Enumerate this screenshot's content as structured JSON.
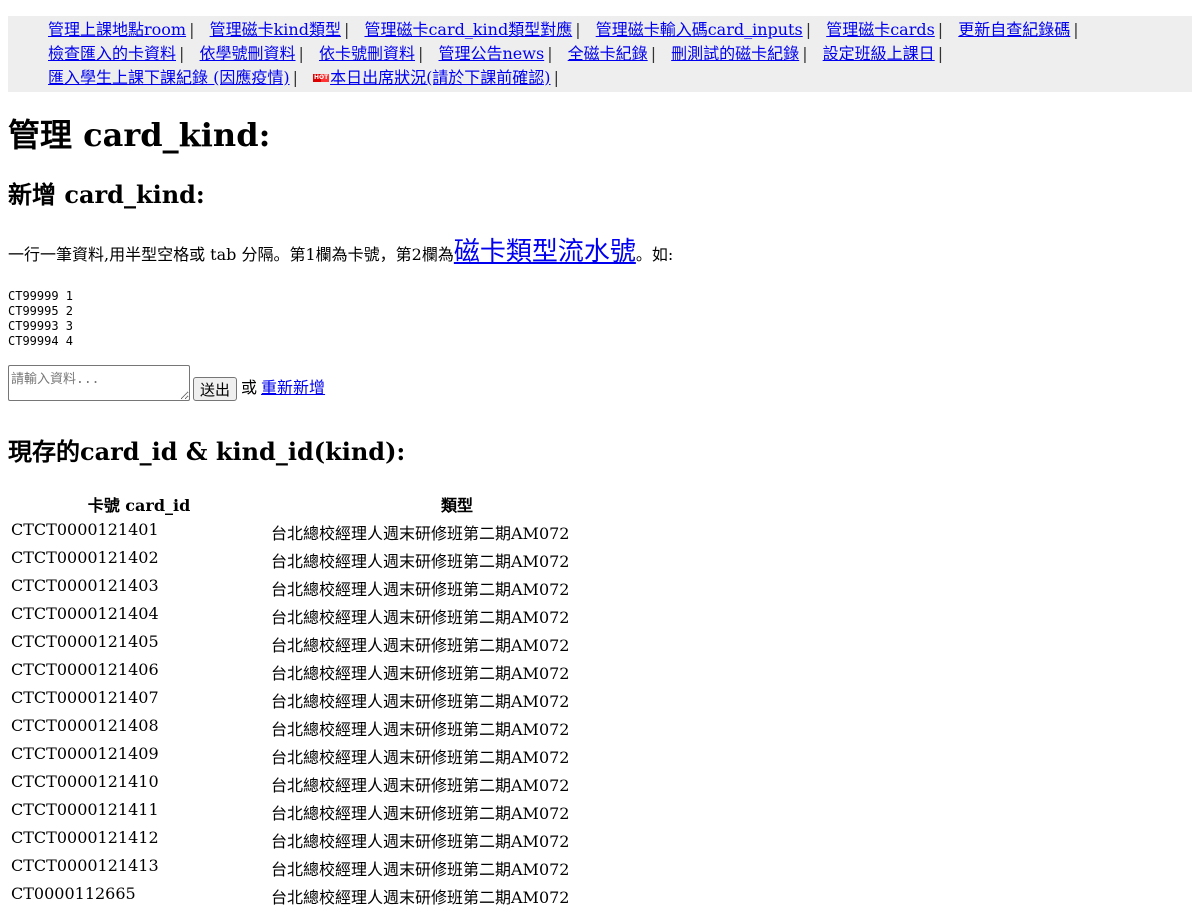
{
  "nav": {
    "items": [
      "管理上課地點room",
      "管理磁卡kind類型",
      "管理磁卡card_kind類型對應",
      "管理磁卡輸入碼card_inputs",
      "管理磁卡cards",
      "更新自查紀錄碼",
      "檢查匯入的卡資料",
      "依學號刪資料",
      "依卡號刪資料",
      "管理公告news",
      "全磁卡紀錄",
      "刪測試的磁卡紀錄",
      "設定班級上課日",
      "匯入學生上課下課紀錄 (因應疫情)",
      "本日出席狀況(請於下課前確認)"
    ],
    "separator": "|",
    "badge_text": "HOT"
  },
  "page_title": "管理 card_kind:",
  "add_section": {
    "heading": "新增 card_kind:",
    "desc_before": "一行一筆資料,用半型空格或 tab 分隔。第1欄為卡號，第2欄為",
    "desc_link": "磁卡類型流水號",
    "desc_after": "。如:",
    "example": "CT99999 1\nCT99995 2\nCT99993 3\nCT99994 4",
    "placeholder": "請輸入資料...",
    "submit_label": "送出",
    "or_text": "或",
    "reset_label": "重新新增"
  },
  "current_section": {
    "heading": "現存的card_id & kind_id(kind):",
    "columns": [
      "卡號 card_id",
      "類型"
    ],
    "rows": [
      [
        "CTCT0000121401",
        "台北總校經理人週末研修班第二期AM072"
      ],
      [
        "CTCT0000121402",
        "台北總校經理人週末研修班第二期AM072"
      ],
      [
        "CTCT0000121403",
        "台北總校經理人週末研修班第二期AM072"
      ],
      [
        "CTCT0000121404",
        "台北總校經理人週末研修班第二期AM072"
      ],
      [
        "CTCT0000121405",
        "台北總校經理人週末研修班第二期AM072"
      ],
      [
        "CTCT0000121406",
        "台北總校經理人週末研修班第二期AM072"
      ],
      [
        "CTCT0000121407",
        "台北總校經理人週末研修班第二期AM072"
      ],
      [
        "CTCT0000121408",
        "台北總校經理人週末研修班第二期AM072"
      ],
      [
        "CTCT0000121409",
        "台北總校經理人週末研修班第二期AM072"
      ],
      [
        "CTCT0000121410",
        "台北總校經理人週末研修班第二期AM072"
      ],
      [
        "CTCT0000121411",
        "台北總校經理人週末研修班第二期AM072"
      ],
      [
        "CTCT0000121412",
        "台北總校經理人週末研修班第二期AM072"
      ],
      [
        "CTCT0000121413",
        "台北總校經理人週末研修班第二期AM072"
      ],
      [
        "CT0000112665",
        "台北總校經理人週末研修班第二期AM072"
      ]
    ]
  },
  "colors": {
    "link": "#0000ee",
    "nav_bg": "#eeeeee",
    "badge": "#dd0000"
  }
}
